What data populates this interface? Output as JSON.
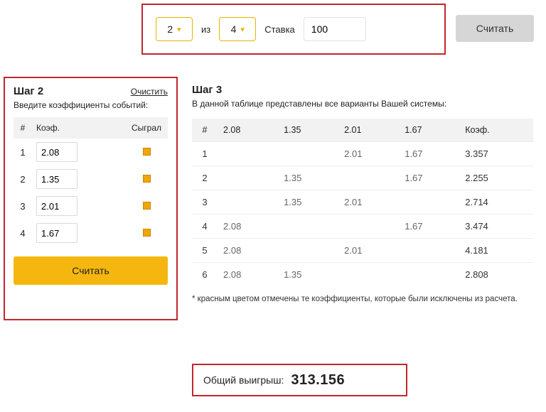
{
  "top": {
    "pick": "2",
    "of_label": "из",
    "total": "4",
    "stake_label": "Ставка",
    "stake_value": "100",
    "compute_label": "Считать"
  },
  "step2": {
    "title": "Шаг 2",
    "clear": "Очистить",
    "prompt": "Введите коэффициенты событий:",
    "headers": {
      "num": "#",
      "coef": "Коэф.",
      "played": "Сыграл"
    },
    "rows": [
      {
        "n": "1",
        "coef": "2.08"
      },
      {
        "n": "2",
        "coef": "1.35"
      },
      {
        "n": "3",
        "coef": "2.01"
      },
      {
        "n": "4",
        "coef": "1.67"
      }
    ],
    "compute_label": "Считать"
  },
  "step3": {
    "title": "Шаг 3",
    "prompt": "В данной таблице представлены все варианты Вашей системы:",
    "headers": [
      "#",
      "2.08",
      "1.35",
      "2.01",
      "1.67",
      "Коэф."
    ],
    "rows": [
      {
        "n": "1",
        "cells": [
          "",
          "",
          "2.01",
          "1.67"
        ],
        "coef": "3.357"
      },
      {
        "n": "2",
        "cells": [
          "",
          "1.35",
          "",
          "1.67"
        ],
        "coef": "2.255"
      },
      {
        "n": "3",
        "cells": [
          "",
          "1.35",
          "2.01",
          ""
        ],
        "coef": "2.714"
      },
      {
        "n": "4",
        "cells": [
          "2.08",
          "",
          "",
          "1.67"
        ],
        "coef": "3.474"
      },
      {
        "n": "5",
        "cells": [
          "2.08",
          "",
          "2.01",
          ""
        ],
        "coef": "4.181"
      },
      {
        "n": "6",
        "cells": [
          "2.08",
          "1.35",
          "",
          ""
        ],
        "coef": "2.808"
      }
    ],
    "footnote": "* красным цветом отмечены те коэффициенты, которые были исключены из расчета."
  },
  "total": {
    "label": "Общий выигрыш:",
    "value": "313.156"
  }
}
